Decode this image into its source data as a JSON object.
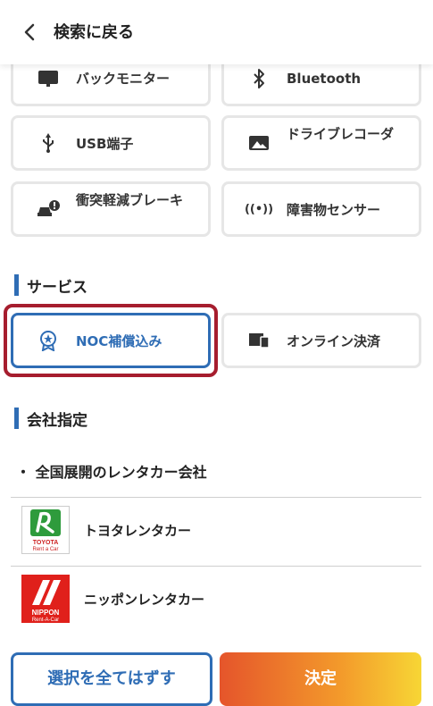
{
  "header": {
    "back_icon": "chevron-left-icon",
    "title": "検索に戻る"
  },
  "equipment": [
    {
      "label": "バックモニター",
      "icon": "monitor-icon"
    },
    {
      "label": "Bluetooth",
      "icon": "bluetooth-icon"
    },
    {
      "label": "USB端子",
      "icon": "usb-icon"
    },
    {
      "label": "ドライブレコーダ",
      "icon": "image-icon"
    },
    {
      "label": "衝突軽減ブレーキ",
      "icon": "car-alert-icon"
    },
    {
      "label": "障害物センサー",
      "icon": "sensor-icon",
      "icon_text": "((•))"
    }
  ],
  "services_section": {
    "title": "サービス",
    "items": [
      {
        "label": "NOC補償込み",
        "icon": "badge-icon",
        "selected": true
      },
      {
        "label": "オンライン決済",
        "icon": "devices-icon",
        "selected": false
      }
    ]
  },
  "company_section": {
    "title": "会社指定",
    "subtitle": "・ 全国展開のレンタカー会社",
    "companies": [
      {
        "name": "トヨタレンタカー",
        "logo": "toyota-rent-a-car-logo",
        "logo_text": "TOYOTA Rent a Car"
      },
      {
        "name": "ニッポンレンタカー",
        "logo": "nippon-rent-a-car-logo",
        "logo_text": "NIPPON Rent-A-Car"
      }
    ]
  },
  "footer": {
    "clear_label": "選択を全てはずす",
    "confirm_label": "決定"
  },
  "colors": {
    "accent": "#2f6db5",
    "selected_outline": "#a61d2e",
    "confirm_start": "#e5552b",
    "confirm_end": "#f7d635"
  }
}
